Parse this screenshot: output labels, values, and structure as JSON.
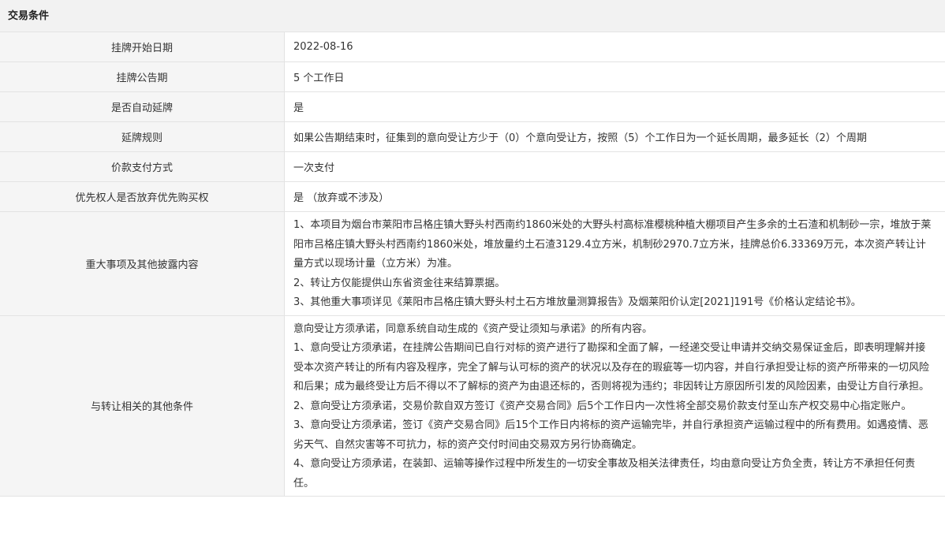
{
  "section": {
    "title": "交易条件"
  },
  "rows": {
    "start_date": {
      "label": "挂牌开始日期",
      "value": "2022-08-16"
    },
    "notice_period": {
      "label": "挂牌公告期",
      "value": "5 个工作日"
    },
    "auto_extend": {
      "label": "是否自动延牌",
      "value": "是"
    },
    "extend_rule": {
      "label": "延牌规则",
      "value": "如果公告期结束时，征集到的意向受让方少于（0）个意向受让方，按照（5）个工作日为一个延长周期，最多延长（2）个周期"
    },
    "payment_method": {
      "label": "价款支付方式",
      "value": "一次支付"
    },
    "preemptive_right": {
      "label": "优先权人是否放弃优先购买权",
      "value": "是 （放弃或不涉及）"
    },
    "major_matters": {
      "label": "重大事项及其他披露内容",
      "paragraphs": [
        "1、本项目为烟台市莱阳市吕格庄镇大野头村西南约1860米处的大野头村高标准樱桃种植大棚项目产生多余的土石渣和机制砂一宗，堆放于莱阳市吕格庄镇大野头村西南约1860米处，堆放量约土石渣3129.4立方米，机制砂2970.7立方米，挂牌总价6.33369万元，本次资产转让计量方式以现场计量（立方米）为准。",
        "2、转让方仅能提供山东省资金往来结算票据。",
        "3、其他重大事项详见《莱阳市吕格庄镇大野头村土石方堆放量测算报告》及烟莱阳价认定[2021]191号《价格认定结论书》。"
      ]
    },
    "other_conditions": {
      "label": "与转让相关的其他条件",
      "paragraphs": [
        "意向受让方须承诺，同意系统自动生成的《资产受让须知与承诺》的所有内容。",
        "1、意向受让方须承诺，在挂牌公告期间已自行对标的资产进行了勘探和全面了解，一经递交受让申请并交纳交易保证金后，即表明理解并接受本次资产转让的所有内容及程序，完全了解与认可标的资产的状况以及存在的瑕疵等一切内容，并自行承担受让标的资产所带来的一切风险和后果；成为最终受让方后不得以不了解标的资产为由退还标的，否则将视为违约；非因转让方原因所引发的风险因素，由受让方自行承担。",
        "2、意向受让方须承诺，交易价款自双方签订《资产交易合同》后5个工作日内一次性将全部交易价款支付至山东产权交易中心指定账户。",
        "3、意向受让方须承诺，签订《资产交易合同》后15个工作日内将标的资产运输完毕，并自行承担资产运输过程中的所有费用。如遇疫情、恶劣天气、自然灾害等不可抗力，标的资产交付时间由交易双方另行协商确定。",
        "4、意向受让方须承诺，在装卸、运输等操作过程中所发生的一切安全事故及相关法律责任，均由意向受让方负全责，转让方不承担任何责任。"
      ]
    }
  }
}
